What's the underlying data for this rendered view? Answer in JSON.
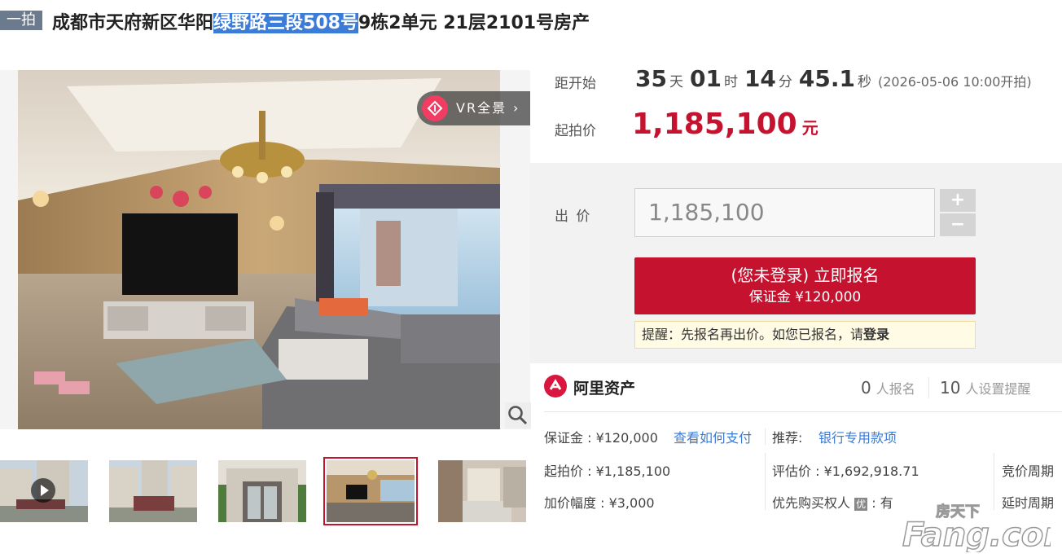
{
  "header": {
    "round_tag": "一拍",
    "title_pre": "成都市天府新区华阳",
    "title_highlight": "绿野路三段508号",
    "title_post": "9栋2单元 21层2101号房产"
  },
  "gallery": {
    "vr_label": "VR全景",
    "vr_chevron": "›",
    "zoom_icon": "zoom-in-icon",
    "thumbnails": [
      {
        "name": "exterior-video",
        "has_video": true,
        "selected": false
      },
      {
        "name": "exterior-gate",
        "has_video": false,
        "selected": false
      },
      {
        "name": "lobby-door",
        "has_video": false,
        "selected": false
      },
      {
        "name": "living-room",
        "has_video": false,
        "selected": true
      },
      {
        "name": "dining-room",
        "has_video": false,
        "selected": false
      }
    ]
  },
  "auction": {
    "countdown_label": "距开始",
    "days": "35",
    "days_unit": "天",
    "hours": "01",
    "hours_unit": "时",
    "minutes": "14",
    "minutes_unit": "分",
    "seconds": "45.1",
    "seconds_unit": "秒",
    "start_note": "(2026-05-06 10:00开拍)",
    "start_price_label": "起拍价",
    "start_price": "1,185,100",
    "start_price_unit": "元"
  },
  "bid": {
    "label": "出 价",
    "value": "1,185,100",
    "plus": "+",
    "minus": "−",
    "signup_main": "(您未登录) 立即报名",
    "signup_sub": "保证金 ¥120,000",
    "reminder_pre": "提醒：先报名再出价。如您已报名，请",
    "reminder_link": "登录"
  },
  "ali": {
    "name": "阿里资产",
    "signup_count": "0",
    "signup_label": "人报名",
    "reminder_count": "10",
    "reminder_label": "人设置提醒"
  },
  "details": {
    "deposit": "保证金 : ¥120,000",
    "how_pay": "查看如何支付",
    "recommend_label": "推荐:",
    "recommend_link": "银行专用款项",
    "start_price": "起拍价 : ¥1,185,100",
    "appraisal": "评估价 : ¥1,692,918.71",
    "bid_cycle": "竞价周期",
    "increment": "加价幅度 : ¥3,000",
    "priority_pre": "优先购买权人",
    "priority_badge": "优",
    "priority_post": ": 有",
    "delay_cycle": "延时周期"
  },
  "watermark": {
    "top": "房天下",
    "bottom": "Fang.com"
  },
  "colors": {
    "accent_red": "#c4122f",
    "link_blue": "#3a7bd5",
    "highlight_blue": "#3b7cd8",
    "ali_red": "#d9163f"
  }
}
